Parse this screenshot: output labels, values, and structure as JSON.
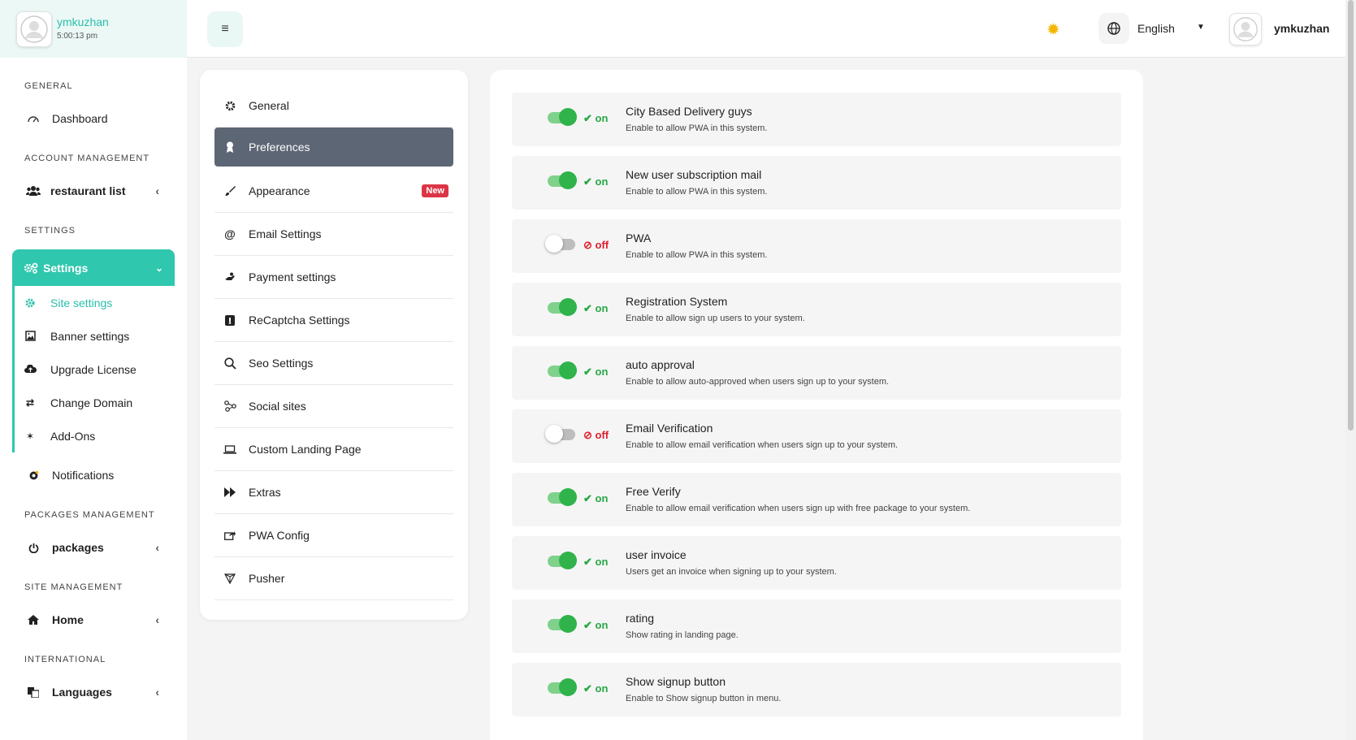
{
  "sidebar": {
    "username": "ymkuzhan",
    "time": "5:00:13 pm",
    "general_heading": "GENERAL",
    "dashboard": "Dashboard",
    "account_heading": "ACCOUNT MANAGEMENT",
    "restaurant_list": "restaurant list",
    "settings_heading": "SETTINGS",
    "settings": "Settings",
    "sub_items": [
      "Site settings",
      "Banner settings",
      "Upgrade License",
      "Change Domain",
      "Add-Ons"
    ],
    "notifications": "Notifications",
    "packages_heading": "PACKAGES MANAGEMENT",
    "packages": "packages",
    "site_heading": "SITE MANAGEMENT",
    "home": "Home",
    "international_heading": "INTERNATIONAL",
    "languages": "Languages"
  },
  "topbar": {
    "language": "English",
    "username": "ymkuzhan"
  },
  "menu": {
    "items": [
      "General",
      "Preferences",
      "Appearance",
      "Email Settings",
      "Payment settings",
      "ReCaptcha Settings",
      "Seo Settings",
      "Social sites",
      "Custom Landing Page",
      "Extras",
      "PWA Config",
      "Pusher"
    ],
    "active_index": 1,
    "new_badge": "New"
  },
  "settings": [
    {
      "title": "City Based Delivery guys",
      "desc": "Enable to allow PWA in this system.",
      "state": "on"
    },
    {
      "title": "New user subscription mail",
      "desc": "Enable to allow PWA in this system.",
      "state": "on"
    },
    {
      "title": "PWA",
      "desc": "Enable to allow PWA in this system.",
      "state": "off"
    },
    {
      "title": "Registration System",
      "desc": "Enable to allow sign up users to your system.",
      "state": "on"
    },
    {
      "title": "auto approval",
      "desc": "Enable to allow auto-approved when users sign up to your system.",
      "state": "on"
    },
    {
      "title": "Email Verification",
      "desc": "Enable to allow email verification when users sign up to your system.",
      "state": "off"
    },
    {
      "title": "Free Verify",
      "desc": "Enable to allow email verification when users sign up with free package to your system.",
      "state": "on"
    },
    {
      "title": "user invoice",
      "desc": "Users get an invoice when signing up to your system.",
      "state": "on"
    },
    {
      "title": "rating",
      "desc": "Show rating in landing page.",
      "state": "on"
    },
    {
      "title": "Show signup button",
      "desc": "Enable to Show signup button in menu.",
      "state": "on"
    }
  ],
  "state_labels": {
    "on": "on",
    "off": "off"
  },
  "colors": {
    "accent": "#2fc7ad",
    "toggle_on": "#2fb34a",
    "off_red": "#e01e2d",
    "active_menu": "#5d6675"
  }
}
